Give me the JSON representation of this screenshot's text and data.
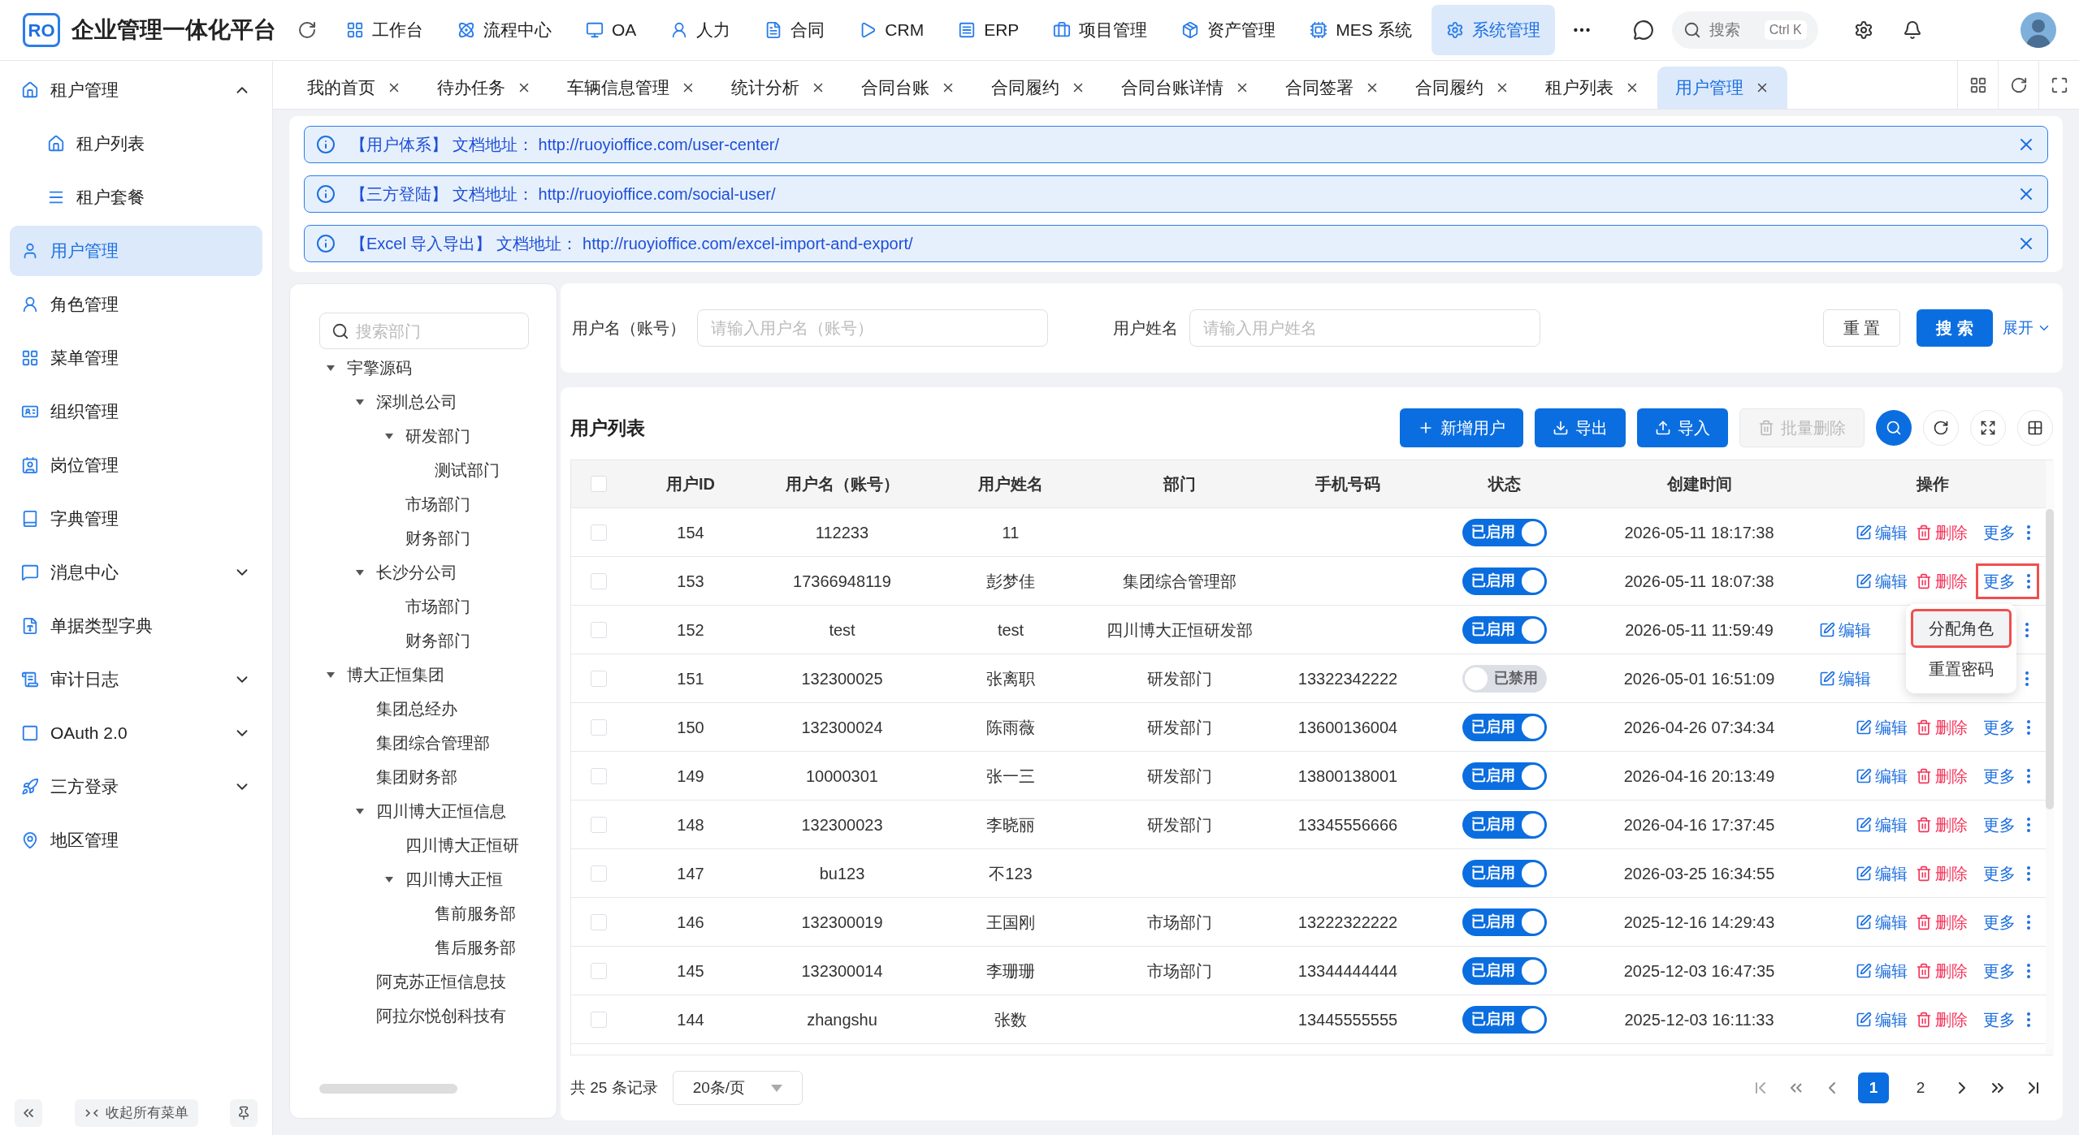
{
  "header": {
    "logo_text": "RO",
    "title": "企业管理一体化平台",
    "nav": [
      {
        "label": "工作台",
        "selected": false
      },
      {
        "label": "流程中心",
        "selected": false
      },
      {
        "label": "OA",
        "selected": false
      },
      {
        "label": "人力",
        "selected": false
      },
      {
        "label": "合同",
        "selected": false
      },
      {
        "label": "CRM",
        "selected": false
      },
      {
        "label": "ERP",
        "selected": false
      },
      {
        "label": "项目管理",
        "selected": false
      },
      {
        "label": "资产管理",
        "selected": false
      },
      {
        "label": "MES 系统",
        "selected": false
      },
      {
        "label": "系统管理",
        "selected": true
      }
    ],
    "search": {
      "placeholder": "搜索",
      "shortcut": "Ctrl K"
    }
  },
  "tabs": [
    {
      "label": "我的首页",
      "selected": false
    },
    {
      "label": "待办任务",
      "selected": false
    },
    {
      "label": "车辆信息管理",
      "selected": false
    },
    {
      "label": "统计分析",
      "selected": false
    },
    {
      "label": "合同台账",
      "selected": false
    },
    {
      "label": "合同履约",
      "selected": false
    },
    {
      "label": "合同台账详情",
      "selected": false
    },
    {
      "label": "合同签署",
      "selected": false
    },
    {
      "label": "合同履约",
      "selected": false
    },
    {
      "label": "租户列表",
      "selected": false
    },
    {
      "label": "用户管理",
      "selected": true
    }
  ],
  "sidebar": {
    "items": [
      {
        "label": "租户管理",
        "selected": false,
        "expanded": true,
        "children": [
          {
            "label": "租户列表",
            "selected": false
          },
          {
            "label": "租户套餐",
            "selected": false
          }
        ]
      },
      {
        "label": "用户管理",
        "selected": true
      },
      {
        "label": "角色管理",
        "selected": false
      },
      {
        "label": "菜单管理",
        "selected": false
      },
      {
        "label": "组织管理",
        "selected": false
      },
      {
        "label": "岗位管理",
        "selected": false
      },
      {
        "label": "字典管理",
        "selected": false
      },
      {
        "label": "消息中心",
        "selected": false,
        "expanded": false
      },
      {
        "label": "单据类型字典",
        "selected": false
      },
      {
        "label": "审计日志",
        "selected": false,
        "expanded": false
      },
      {
        "label": "OAuth 2.0",
        "selected": false,
        "expanded": false
      },
      {
        "label": "三方登录",
        "selected": false,
        "expanded": false
      },
      {
        "label": "地区管理",
        "selected": false
      }
    ],
    "collapse_all": "收起所有菜单"
  },
  "notices": [
    {
      "tag": "【用户体系】",
      "label": "文档地址：",
      "link": "http://ruoyioffice.com/user-center/"
    },
    {
      "tag": "【三方登陆】",
      "label": "文档地址：",
      "link": "http://ruoyioffice.com/social-user/"
    },
    {
      "tag": "【Excel 导入导出】",
      "label": "文档地址：",
      "link": "http://ruoyioffice.com/excel-import-and-export/"
    }
  ],
  "dept_tree": {
    "search_placeholder": "搜索部门",
    "nodes": [
      {
        "label": "宇擎源码",
        "expanded": true,
        "children": [
          {
            "label": "深圳总公司",
            "expanded": true,
            "children": [
              {
                "label": "研发部门",
                "expanded": true,
                "children": [
                  {
                    "label": "测试部门"
                  }
                ]
              },
              {
                "label": "市场部门"
              },
              {
                "label": "财务部门"
              }
            ]
          },
          {
            "label": "长沙分公司",
            "expanded": true,
            "children": [
              {
                "label": "市场部门"
              },
              {
                "label": "财务部门"
              }
            ]
          }
        ]
      },
      {
        "label": "博大正恒集团",
        "expanded": true,
        "children": [
          {
            "label": "集团总经办"
          },
          {
            "label": "集团综合管理部"
          },
          {
            "label": "集团财务部"
          },
          {
            "label": "四川博大正恒信息",
            "expanded": true,
            "children": [
              {
                "label": "四川博大正恒研"
              },
              {
                "label": "四川博大正恒",
                "expanded": true,
                "children": [
                  {
                    "label": "售前服务部"
                  },
                  {
                    "label": "售后服务部"
                  }
                ]
              }
            ]
          },
          {
            "label": "阿克苏正恒信息技"
          },
          {
            "label": "阿拉尔悦创科技有"
          }
        ]
      }
    ]
  },
  "filters": [
    {
      "label": "用户名（账号）",
      "placeholder": "请输入用户名（账号）"
    },
    {
      "label": "用户姓名",
      "placeholder": "请输入用户姓名"
    }
  ],
  "filter_buttons": {
    "reset": "重 置",
    "search": "搜 索",
    "expand": "展开"
  },
  "table": {
    "title": "用户列表",
    "toolbar": [
      {
        "label": "新增用户",
        "disabled": false
      },
      {
        "label": "导出",
        "disabled": false
      },
      {
        "label": "导入",
        "disabled": false
      },
      {
        "label": "批量删除",
        "disabled": true
      }
    ],
    "header_checked": false,
    "columns": [
      "用户ID",
      "用户名（账号）",
      "用户姓名",
      "部门",
      "手机号码",
      "状态",
      "创建时间",
      "操作"
    ],
    "rows": [
      {
        "checked": false,
        "cells": [
          "154",
          "112233",
          "11",
          "",
          ""
        ],
        "status": {
          "label": "已启用",
          "on": true
        },
        "created": "2026-05-11 18:17:38",
        "actions": [
          {
            "kind": "edit",
            "label": "编辑"
          },
          {
            "kind": "delete",
            "label": "删除"
          },
          {
            "kind": "more",
            "label": "更多"
          }
        ]
      },
      {
        "checked": false,
        "cells": [
          "153",
          "17366948119",
          "彭梦佳",
          "集团综合管理部",
          ""
        ],
        "status": {
          "label": "已启用",
          "on": true
        },
        "created": "2026-05-11 18:07:38",
        "actions": [
          {
            "kind": "edit",
            "label": "编辑"
          },
          {
            "kind": "delete",
            "label": "删除"
          },
          {
            "kind": "more",
            "label": "更多",
            "highlighted": true
          }
        ],
        "menu": [
          {
            "label": "分配角色",
            "highlighted": true
          },
          {
            "label": "重置密码",
            "highlighted": false
          }
        ]
      },
      {
        "checked": false,
        "cells": [
          "152",
          "test",
          "test",
          "四川博大正恒研发部",
          ""
        ],
        "status": {
          "label": "已启用",
          "on": true
        },
        "created": "2026-05-11 11:59:49",
        "actions": [
          {
            "kind": "edit",
            "label": "编辑"
          }
        ]
      },
      {
        "checked": false,
        "cells": [
          "151",
          "132300025",
          "张离职",
          "研发部门",
          "13322342222"
        ],
        "status": {
          "label": "已禁用",
          "on": false
        },
        "created": "2026-05-01 16:51:09",
        "actions": [
          {
            "kind": "edit",
            "label": "编辑"
          }
        ]
      },
      {
        "checked": false,
        "cells": [
          "150",
          "132300024",
          "陈雨薇",
          "研发部门",
          "13600136004"
        ],
        "status": {
          "label": "已启用",
          "on": true
        },
        "created": "2026-04-26 07:34:34",
        "actions": [
          {
            "kind": "edit",
            "label": "编辑"
          },
          {
            "kind": "delete",
            "label": "删除"
          },
          {
            "kind": "more",
            "label": "更多"
          }
        ]
      },
      {
        "checked": false,
        "cells": [
          "149",
          "10000301",
          "张一三",
          "研发部门",
          "13800138001"
        ],
        "status": {
          "label": "已启用",
          "on": true
        },
        "created": "2026-04-16 20:13:49",
        "actions": [
          {
            "kind": "edit",
            "label": "编辑"
          },
          {
            "kind": "delete",
            "label": "删除"
          },
          {
            "kind": "more",
            "label": "更多"
          }
        ]
      },
      {
        "checked": false,
        "cells": [
          "148",
          "132300023",
          "李晓丽",
          "研发部门",
          "13345556666"
        ],
        "status": {
          "label": "已启用",
          "on": true
        },
        "created": "2026-04-16 17:37:45",
        "actions": [
          {
            "kind": "edit",
            "label": "编辑"
          },
          {
            "kind": "delete",
            "label": "删除"
          },
          {
            "kind": "more",
            "label": "更多"
          }
        ]
      },
      {
        "checked": false,
        "cells": [
          "147",
          "bu123",
          "不123",
          "",
          ""
        ],
        "status": {
          "label": "已启用",
          "on": true
        },
        "created": "2026-03-25 16:34:55",
        "actions": [
          {
            "kind": "edit",
            "label": "编辑"
          },
          {
            "kind": "delete",
            "label": "删除"
          },
          {
            "kind": "more",
            "label": "更多"
          }
        ]
      },
      {
        "checked": false,
        "cells": [
          "146",
          "132300019",
          "王国刚",
          "市场部门",
          "13222322222"
        ],
        "status": {
          "label": "已启用",
          "on": true
        },
        "created": "2025-12-16 14:29:43",
        "actions": [
          {
            "kind": "edit",
            "label": "编辑"
          },
          {
            "kind": "delete",
            "label": "删除"
          },
          {
            "kind": "more",
            "label": "更多"
          }
        ]
      },
      {
        "checked": false,
        "cells": [
          "145",
          "132300014",
          "李珊珊",
          "市场部门",
          "13344444444"
        ],
        "status": {
          "label": "已启用",
          "on": true
        },
        "created": "2025-12-03 16:47:35",
        "actions": [
          {
            "kind": "edit",
            "label": "编辑"
          },
          {
            "kind": "delete",
            "label": "删除"
          },
          {
            "kind": "more",
            "label": "更多"
          }
        ]
      },
      {
        "checked": false,
        "cells": [
          "144",
          "zhangshu",
          "张数",
          "",
          "13445555555"
        ],
        "status": {
          "label": "已启用",
          "on": true
        },
        "created": "2025-12-03 16:11:33",
        "actions": [
          {
            "kind": "edit",
            "label": "编辑"
          },
          {
            "kind": "delete",
            "label": "删除"
          },
          {
            "kind": "more",
            "label": "更多"
          }
        ]
      }
    ]
  },
  "pagination": {
    "total": "共 25 条记录",
    "page_size": "20条/页",
    "pages": [
      {
        "label": "1",
        "selected": true
      },
      {
        "label": "2",
        "selected": false
      }
    ]
  }
}
